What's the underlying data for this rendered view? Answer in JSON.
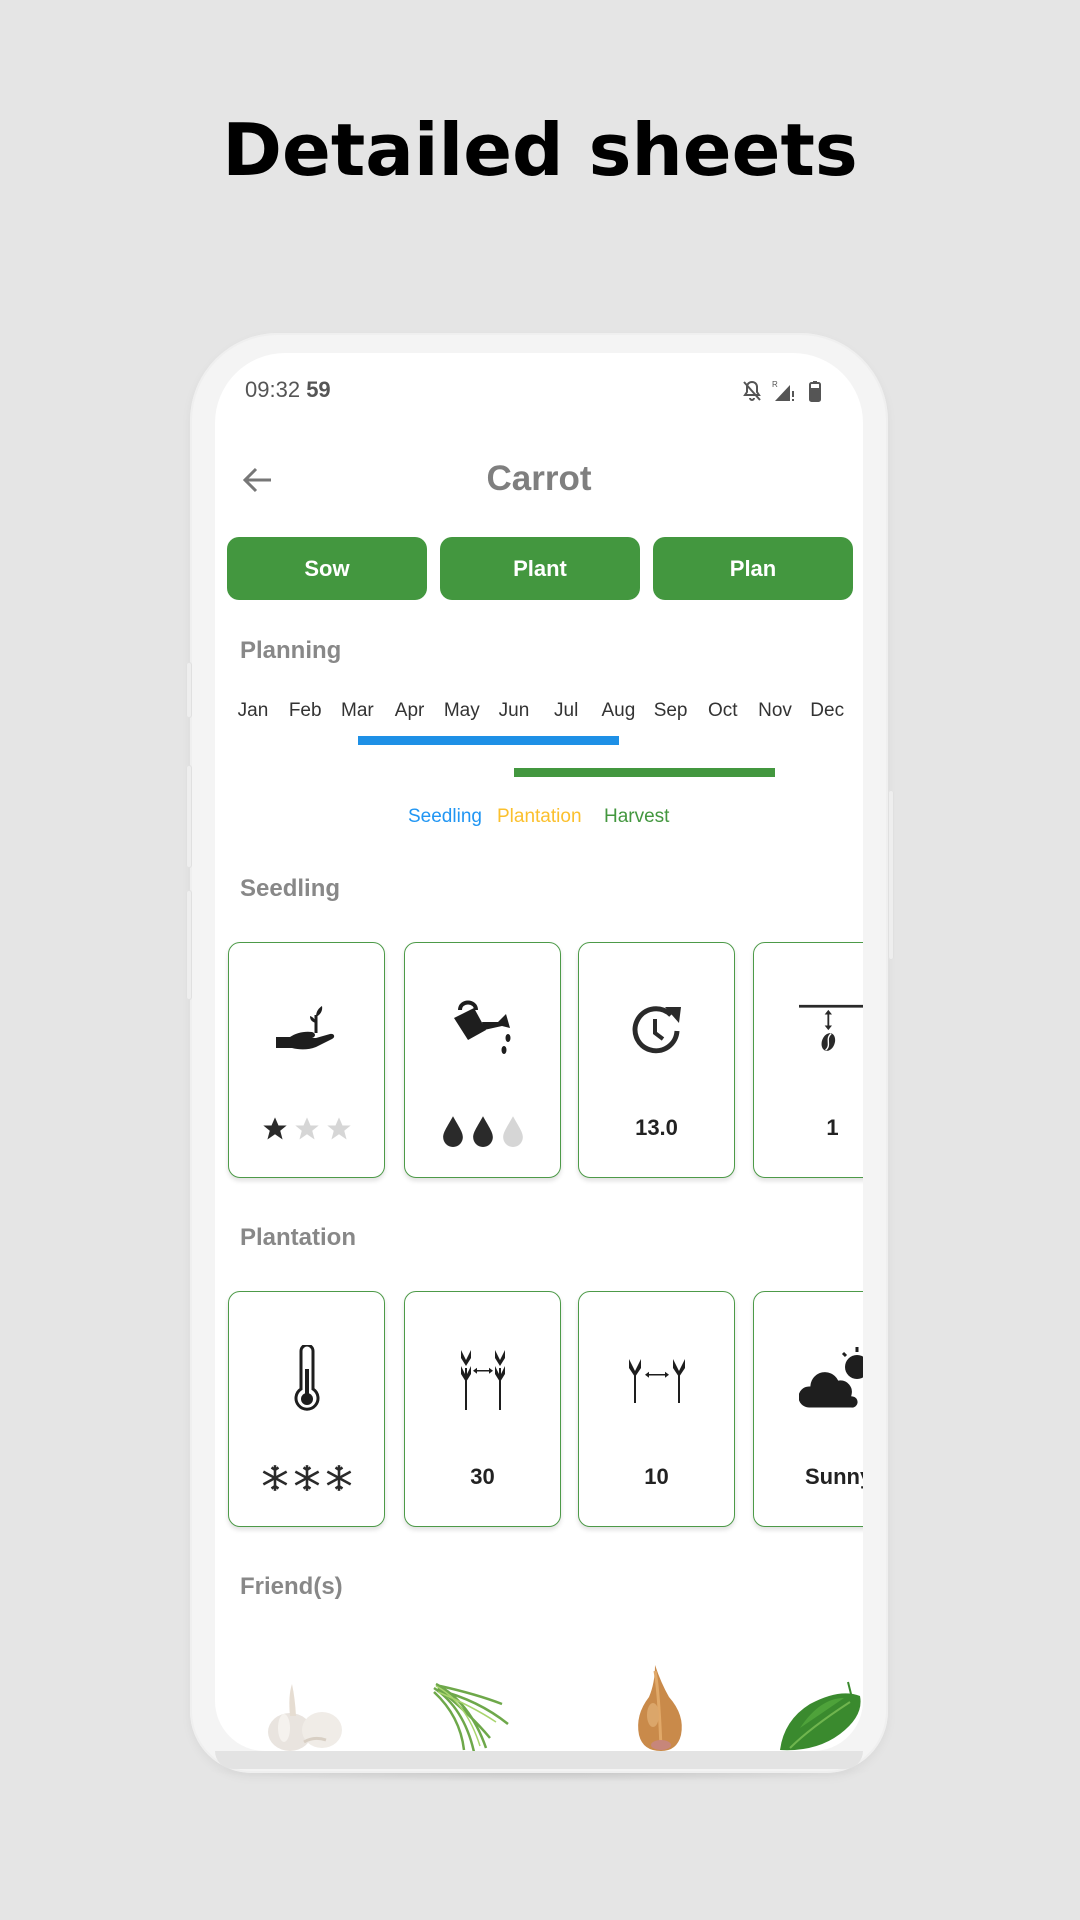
{
  "headline": "Detailed sheets",
  "status_bar": {
    "time": "09:32",
    "seconds": "59",
    "icons": [
      "bell-off-icon",
      "signal-roaming-icon",
      "battery-icon"
    ]
  },
  "app_bar": {
    "back_icon": "arrow-left-icon",
    "title": "Carrot"
  },
  "actions": [
    {
      "label": "Sow"
    },
    {
      "label": "Plant"
    },
    {
      "label": "Plan"
    }
  ],
  "planning": {
    "label": "Planning",
    "months": [
      "Jan",
      "Feb",
      "Mar",
      "Apr",
      "May",
      "Jun",
      "Jul",
      "Aug",
      "Sep",
      "Oct",
      "Nov",
      "Dec"
    ],
    "periods": [
      {
        "name": "Seedling",
        "color": "#1e90e6",
        "start_month": 2.5,
        "end_month": 7.5
      },
      {
        "name": "Harvest",
        "color": "#43973f",
        "start_month": 5.5,
        "end_month": 10.5
      }
    ],
    "legend": [
      {
        "label": "Seedling",
        "color": "#2196f3"
      },
      {
        "label": "Plantation",
        "color": "#fbc02d"
      },
      {
        "label": "Harvest",
        "color": "#43973f"
      }
    ]
  },
  "seedling": {
    "label": "Seedling",
    "cards": [
      {
        "icon": "hand-sprout-icon",
        "type": "rating",
        "rating_icon": "star",
        "filled": 1,
        "total": 3
      },
      {
        "icon": "watering-can-icon",
        "type": "rating",
        "rating_icon": "drop",
        "filled": 2,
        "total": 3
      },
      {
        "icon": "clock-refresh-icon",
        "type": "value",
        "value": "13.0"
      },
      {
        "icon": "sowing-depth-icon",
        "type": "value",
        "value": "1"
      }
    ]
  },
  "plantation": {
    "label": "Plantation",
    "cards": [
      {
        "icon": "thermometer-icon",
        "type": "rating",
        "rating_icon": "snowflake",
        "filled": 3,
        "total": 3
      },
      {
        "icon": "row-spacing-icon",
        "type": "value",
        "value": "30"
      },
      {
        "icon": "plant-spacing-icon",
        "type": "value",
        "value": "10"
      },
      {
        "icon": "sun-cloud-icon",
        "type": "value",
        "value": "Sunny"
      }
    ]
  },
  "friends": {
    "label": "Friend(s)",
    "items": [
      {
        "name": "garlic"
      },
      {
        "name": "chives"
      },
      {
        "name": "shallot"
      },
      {
        "name": "spinach"
      }
    ]
  },
  "colors": {
    "accent": "#43973f",
    "seedling": "#1e90e6",
    "plantation": "#fbc02d",
    "harvest": "#43973f",
    "section_label": "#888888"
  }
}
